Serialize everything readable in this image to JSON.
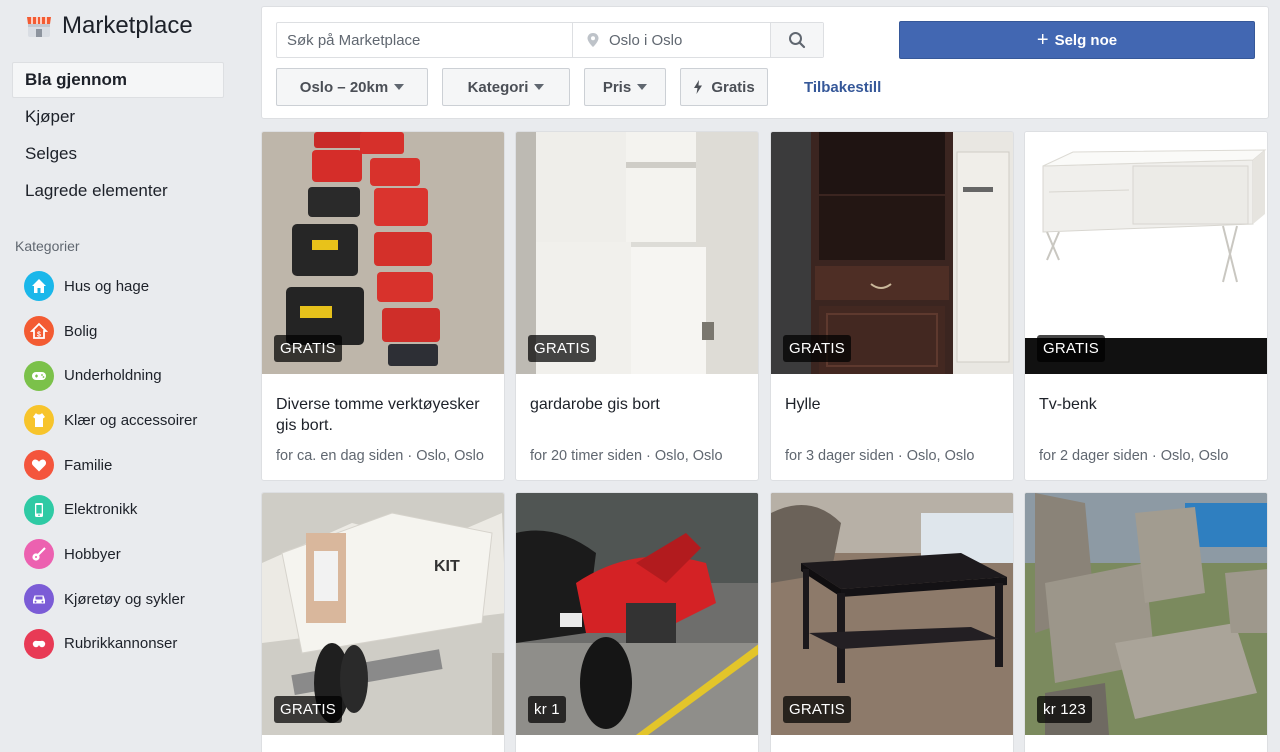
{
  "app": {
    "title": "Marketplace"
  },
  "nav": [
    {
      "label": "Bla gjennom",
      "active": true
    },
    {
      "label": "Kjøper"
    },
    {
      "label": "Selges"
    },
    {
      "label": "Lagrede elementer"
    }
  ],
  "categories": {
    "heading": "Kategorier",
    "items": [
      {
        "label": "Hus og hage",
        "icon": "house-icon",
        "color": "#1ab7ea"
      },
      {
        "label": "Bolig",
        "icon": "home-icon",
        "color": "#f35b32"
      },
      {
        "label": "Underholdning",
        "icon": "gamepad-icon",
        "color": "#7bc14a"
      },
      {
        "label": "Klær og accessoirer",
        "icon": "clothing-icon",
        "color": "#f7c42b"
      },
      {
        "label": "Familie",
        "icon": "heart-icon",
        "color": "#f4553c"
      },
      {
        "label": "Elektronikk",
        "icon": "phone-icon",
        "color": "#2ecaa4"
      },
      {
        "label": "Hobbyer",
        "icon": "guitar-icon",
        "color": "#ec61b0"
      },
      {
        "label": "Kjøretøy og sykler",
        "icon": "car-icon",
        "color": "#7b5cd6"
      },
      {
        "label": "Rubrikkannonser",
        "icon": "classifieds-icon",
        "color": "#e83a55"
      }
    ]
  },
  "search": {
    "placeholder": "Søk på Marketplace",
    "location_placeholder": "Oslo i Oslo"
  },
  "sell_button": {
    "label": "Selg noe"
  },
  "filters": {
    "location": "Oslo – 20km",
    "category": "Kategori",
    "price": "Pris",
    "free": "Gratis",
    "reset": "Tilbakestill"
  },
  "listings": [
    {
      "badge": "GRATIS",
      "title": "Diverse tomme verktøyesker gis bort.",
      "meta": "for ca. en dag siden · Oslo, Oslo"
    },
    {
      "badge": "GRATIS",
      "title": "gardarobe gis bort",
      "meta": "for 20 timer siden · Oslo, Oslo"
    },
    {
      "badge": "GRATIS",
      "title": "Hylle",
      "meta": "for 3 dager siden · Oslo, Oslo"
    },
    {
      "badge": "GRATIS",
      "title": "Tv-benk",
      "meta": "for 2 dager siden · Oslo, Oslo"
    },
    {
      "badge": "GRATIS",
      "title": "",
      "meta": ""
    },
    {
      "badge": "kr 1",
      "title": "",
      "meta": ""
    },
    {
      "badge": "GRATIS",
      "title": "",
      "meta": ""
    },
    {
      "badge": "kr 123",
      "title": "",
      "meta": ""
    }
  ]
}
